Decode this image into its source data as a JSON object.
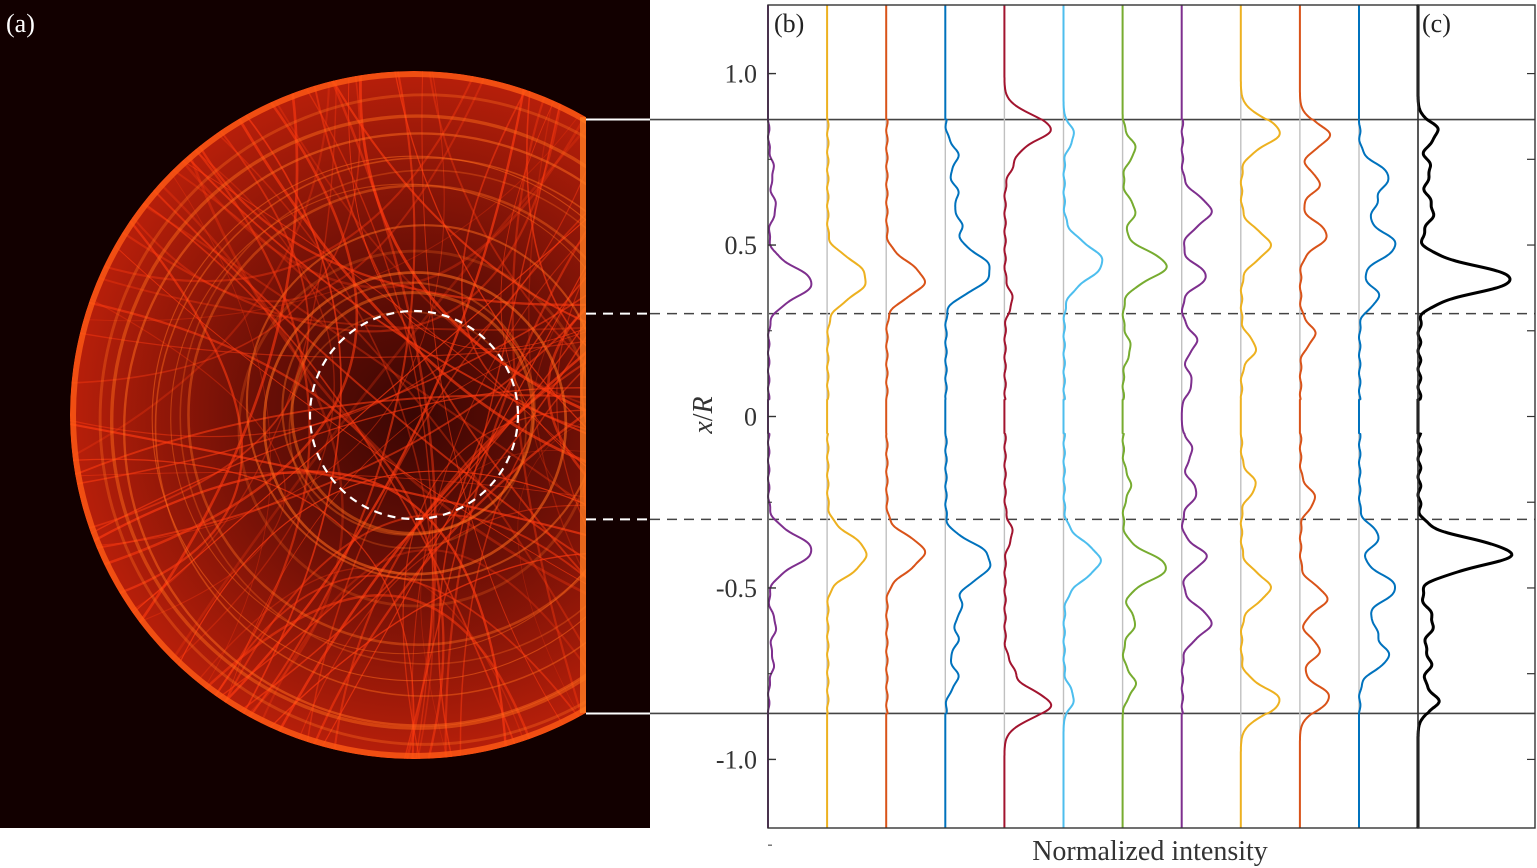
{
  "panel_labels": {
    "a": "(a)",
    "b": "(b)",
    "c": "(c)"
  },
  "axes": {
    "ylabel_var": "x",
    "ylabel_sep": "/",
    "ylabel_var2": "R",
    "xlabel": "Normalized intensity"
  },
  "colors": {
    "background_map": "#120000",
    "pattern": "#ff3a10",
    "purple": "#7e2f8e",
    "yellow": "#edb120",
    "orange": "#d95319",
    "blue": "#0072bd",
    "crimson": "#a2142f",
    "cyan": "#4dbeee",
    "green": "#77ac30",
    "black": "#000000",
    "gray_baseline": "#c0c0c0"
  },
  "chart_data": [
    {
      "panel": "(a)",
      "type": "heatmap",
      "description_of_content": "half-disk intensity map with inner dashed circle",
      "circle_outer_radius": 1.0,
      "inner_dashed_radius": 0.3,
      "flat_edge_half_height": 0.866
    },
    {
      "panel": "(b)",
      "type": "line",
      "ylim": [
        -1.2,
        1.2
      ],
      "yticks": [
        -1.0,
        -0.5,
        0,
        0.5,
        1.0
      ],
      "ytick_labels": [
        "-1.0",
        "-0.5",
        "0",
        "0.5",
        "1.0"
      ],
      "solid_hlines": [
        0.866,
        -0.866
      ],
      "dashed_hlines": [
        0.3,
        -0.3
      ],
      "series": [
        {
          "color": "purple",
          "peaks": [
            [
              0.39,
              0.9,
              0.045
            ],
            [
              -0.39,
              0.9,
              0.045
            ],
            [
              0.61,
              0.15,
              0.03
            ],
            [
              -0.61,
              0.15,
              0.03
            ],
            [
              0.72,
              0.1,
              0.03
            ],
            [
              -0.72,
              0.1,
              0.03
            ]
          ]
        },
        {
          "color": "yellow",
          "peaks": [
            [
              0.39,
              0.75,
              0.045
            ],
            [
              -0.39,
              0.75,
              0.045
            ],
            [
              0.45,
              0.25,
              0.03
            ],
            [
              -0.45,
              0.25,
              0.03
            ]
          ]
        },
        {
          "color": "orange",
          "peaks": [
            [
              0.39,
              0.75,
              0.04
            ],
            [
              -0.39,
              0.75,
              0.04
            ],
            [
              0.45,
              0.2,
              0.03
            ],
            [
              -0.45,
              0.2,
              0.03
            ]
          ]
        },
        {
          "color": "blue",
          "peaks": [
            [
              0.44,
              0.85,
              0.045
            ],
            [
              -0.44,
              0.85,
              0.045
            ],
            [
              0.38,
              0.35,
              0.03
            ],
            [
              -0.38,
              0.35,
              0.03
            ],
            [
              0.56,
              0.3,
              0.03
            ],
            [
              -0.56,
              0.3,
              0.03
            ],
            [
              0.65,
              0.25,
              0.03
            ],
            [
              -0.65,
              0.25,
              0.03
            ],
            [
              0.76,
              0.25,
              0.03
            ],
            [
              -0.76,
              0.25,
              0.03
            ]
          ]
        },
        {
          "color": "crimson",
          "peaks": [
            [
              0.84,
              0.95,
              0.04
            ],
            [
              -0.84,
              0.95,
              0.04
            ],
            [
              0.74,
              0.15,
              0.03
            ],
            [
              -0.74,
              0.15,
              0.03
            ],
            [
              0.34,
              0.15,
              0.03
            ],
            [
              -0.34,
              0.15,
              0.03
            ]
          ]
        },
        {
          "color": "cyan",
          "peaks": [
            [
              0.45,
              0.8,
              0.05
            ],
            [
              -0.42,
              0.75,
              0.05
            ],
            [
              0.82,
              0.2,
              0.03
            ],
            [
              -0.82,
              0.2,
              0.03
            ]
          ]
        },
        {
          "color": "green",
          "peaks": [
            [
              0.44,
              0.9,
              0.04
            ],
            [
              -0.44,
              0.9,
              0.04
            ],
            [
              0.78,
              0.25,
              0.03
            ],
            [
              -0.78,
              0.25,
              0.03
            ],
            [
              0.6,
              0.25,
              0.03
            ],
            [
              -0.6,
              0.25,
              0.03
            ],
            [
              0.2,
              0.15,
              0.03
            ],
            [
              -0.2,
              0.15,
              0.03
            ]
          ]
        },
        {
          "color": "purple",
          "peaks": [
            [
              0.6,
              0.6,
              0.04
            ],
            [
              -0.6,
              0.6,
              0.04
            ],
            [
              0.41,
              0.5,
              0.03
            ],
            [
              -0.41,
              0.5,
              0.03
            ],
            [
              0.22,
              0.3,
              0.03
            ],
            [
              -0.22,
              0.3,
              0.03
            ],
            [
              0.1,
              0.2,
              0.03
            ],
            [
              -0.1,
              0.2,
              0.03
            ]
          ]
        },
        {
          "color": "yellow",
          "peaks": [
            [
              0.83,
              0.8,
              0.04
            ],
            [
              -0.83,
              0.8,
              0.04
            ],
            [
              0.5,
              0.6,
              0.04
            ],
            [
              -0.5,
              0.6,
              0.04
            ],
            [
              0.2,
              0.3,
              0.03
            ],
            [
              -0.2,
              0.3,
              0.03
            ]
          ]
        },
        {
          "color": "orange",
          "peaks": [
            [
              0.82,
              0.6,
              0.035
            ],
            [
              -0.82,
              0.6,
              0.035
            ],
            [
              0.53,
              0.55,
              0.035
            ],
            [
              -0.53,
              0.55,
              0.035
            ],
            [
              0.68,
              0.4,
              0.03
            ],
            [
              -0.68,
              0.4,
              0.03
            ],
            [
              0.24,
              0.3,
              0.03
            ],
            [
              -0.24,
              0.3,
              0.03
            ]
          ]
        },
        {
          "color": "blue",
          "peaks": [
            [
              0.5,
              0.75,
              0.04
            ],
            [
              -0.5,
              0.75,
              0.04
            ],
            [
              0.7,
              0.6,
              0.035
            ],
            [
              -0.7,
              0.6,
              0.035
            ],
            [
              0.35,
              0.4,
              0.03
            ],
            [
              -0.35,
              0.4,
              0.03
            ],
            [
              0.62,
              0.3,
              0.03
            ],
            [
              -0.62,
              0.3,
              0.03
            ]
          ]
        }
      ]
    },
    {
      "panel": "(c)",
      "type": "line",
      "ylim": [
        -1.2,
        1.2
      ],
      "series": [
        {
          "color": "black",
          "peaks": [
            [
              0.4,
              1.0,
              0.04
            ],
            [
              -0.4,
              1.0,
              0.04
            ],
            [
              0.83,
              0.2,
              0.03
            ],
            [
              -0.83,
              0.2,
              0.03
            ],
            [
              0.6,
              0.15,
              0.04
            ],
            [
              -0.6,
              0.15,
              0.04
            ],
            [
              0.72,
              0.12,
              0.03
            ],
            [
              -0.72,
              0.12,
              0.03
            ]
          ]
        }
      ]
    }
  ]
}
